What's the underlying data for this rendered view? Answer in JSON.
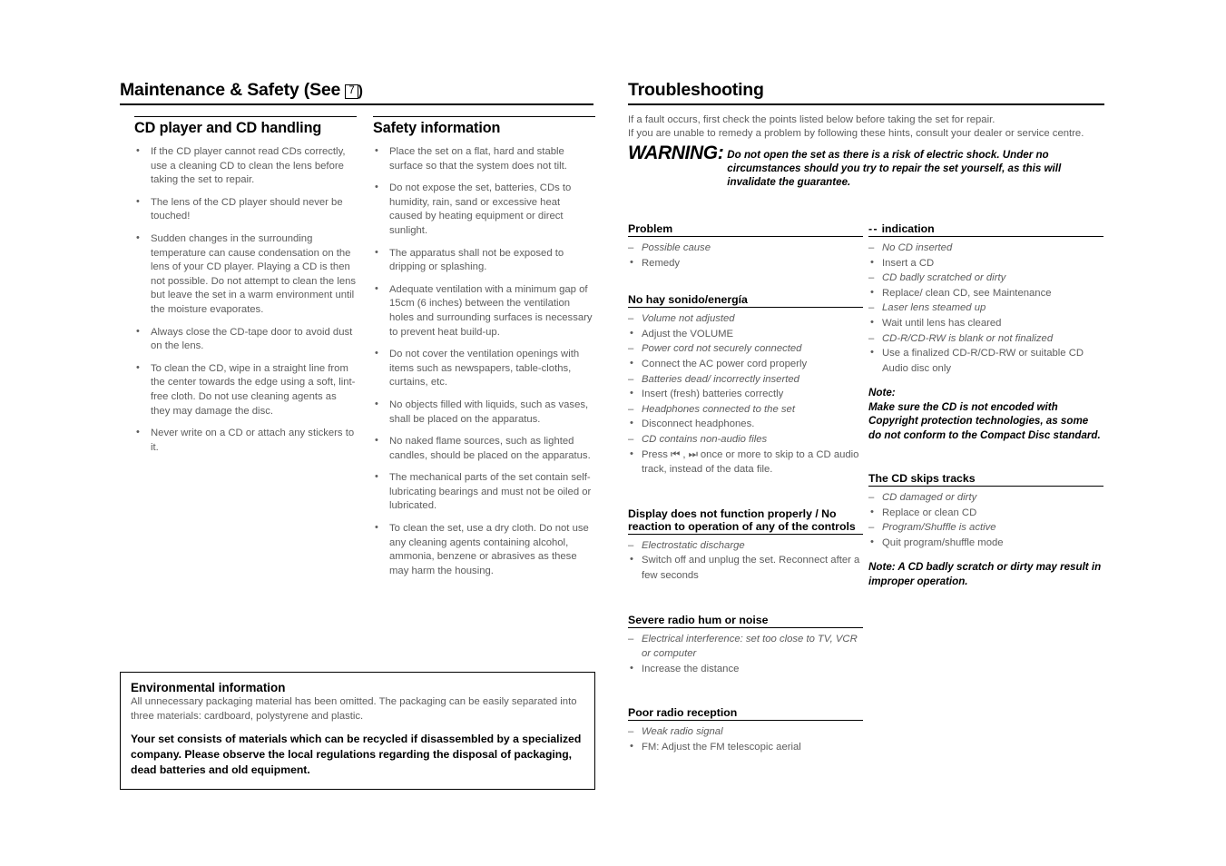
{
  "left": {
    "main_title_prefix": "Maintenance & Safety (See",
    "main_title_box": "7",
    "main_title_suffix": ")",
    "sections": [
      {
        "title": "CD player and CD handling",
        "bullets": [
          "If the CD player cannot read CDs correctly, use a cleaning CD to clean the lens before taking the set to repair.",
          "The lens of the CD player should never be touched!",
          "Sudden changes in the surrounding temperature can cause condensation on the lens of your CD player. Playing a CD is then not possible. Do not attempt to clean the lens but leave the set in a warm environment until the moisture evaporates.",
          "Always close the CD-tape door to avoid dust on the lens.",
          "To clean the CD, wipe in a straight line from the center towards the edge using a soft, lint-free cloth. Do not use cleaning agents as they may damage the disc.",
          "Never write on a CD or attach any stickers to it."
        ]
      },
      {
        "title": "Safety information",
        "bullets": [
          "Place the set on a flat, hard and stable surface so that the system does not tilt.",
          "Do not expose the set, batteries, CDs to humidity, rain, sand or excessive heat caused by heating equipment or direct sunlight.",
          "The apparatus shall not be exposed to dripping or splashing.",
          "Adequate ventilation with a minimum gap of 15cm (6 inches) between the ventilation holes and surrounding surfaces is necessary to prevent heat build-up.",
          "Do not cover the ventilation openings with items such as newspapers, table-cloths, curtains, etc.",
          "No objects filled with liquids, such as vases, shall be placed on the apparatus.",
          "No naked flame sources, such as lighted candles, should be placed on the apparatus.",
          "The mechanical parts of the set contain self-lubricating bearings and must not be oiled or lubricated.",
          "To clean the set, use a dry cloth. Do not use any cleaning agents containing alcohol, ammonia, benzene or abrasives as these may harm the housing."
        ]
      }
    ],
    "environmental": {
      "title": "Environmental information",
      "paragraph": "All unnecessary packaging material has been omitted. The packaging can be easily separated into three materials: cardboard, polystyrene and plastic.",
      "bold_paragraph": "Your set consists of materials which can be recycled if disassembled by a specialized company. Please observe the local regulations regarding the disposal of packaging, dead batteries and old equipment."
    }
  },
  "right": {
    "title": "Troubleshooting",
    "intro_line_1": "If a fault occurs, first check the points listed below before taking the set for repair.",
    "intro_line_2": "If you are unable to remedy a problem by following these hints, consult your dealer or service centre.",
    "warning_label": "WARNING:",
    "warning_text": "Do not open the set as there is a risk of electric shock. Under no circumstances should you try to repair the set yourself, as this will invalidate the guarantee.",
    "col_left": {
      "blocks": [
        {
          "heading": "Problem",
          "dash_prefix": "",
          "items": [
            {
              "kind": "cause",
              "text": "Possible cause"
            },
            {
              "kind": "remedy",
              "text": "Remedy"
            }
          ]
        },
        {
          "heading": "No hay sonido/energía",
          "dash_prefix": "",
          "items": [
            {
              "kind": "cause",
              "text": "Volume not adjusted"
            },
            {
              "kind": "remedy",
              "text": "Adjust the VOLUME"
            },
            {
              "kind": "cause",
              "text": "Power cord not securely connected"
            },
            {
              "kind": "remedy",
              "text": "Connect the AC power cord properly"
            },
            {
              "kind": "cause",
              "text": "Batteries dead/ incorrectly inserted"
            },
            {
              "kind": "remedy",
              "text": "Insert (fresh) batteries correctly"
            },
            {
              "kind": "cause",
              "text": "Headphones connected to the set"
            },
            {
              "kind": "remedy",
              "text": "Disconnect headphones."
            },
            {
              "kind": "cause",
              "text": "CD contains non-audio files"
            },
            {
              "kind": "remedy",
              "text": "Press ⏮ , ⏭ once or more to skip to a CD audio track, instead of the data file."
            }
          ]
        },
        {
          "heading": "Display does not function properly / No reaction to operation of any of the controls",
          "dash_prefix": "",
          "items": [
            {
              "kind": "cause",
              "text": "Electrostatic discharge"
            },
            {
              "kind": "remedy",
              "text": "Switch off and unplug the set. Reconnect after a few seconds"
            }
          ]
        },
        {
          "heading": "Severe radio hum or noise",
          "dash_prefix": "",
          "items": [
            {
              "kind": "cause",
              "text": "Electrical interference: set too close to TV, VCR or computer"
            },
            {
              "kind": "remedy",
              "text": "Increase the distance"
            }
          ]
        },
        {
          "heading": "Poor radio reception",
          "dash_prefix": "",
          "items": [
            {
              "kind": "cause",
              "text": "Weak radio signal"
            },
            {
              "kind": "remedy",
              "text": "FM: Adjust the FM telescopic aerial"
            }
          ]
        }
      ]
    },
    "col_right": {
      "blocks": [
        {
          "heading": "indication",
          "dash_prefix": "- -",
          "items": [
            {
              "kind": "cause",
              "text": "No CD inserted"
            },
            {
              "kind": "remedy",
              "text": "Insert a CD"
            },
            {
              "kind": "cause",
              "text": "CD badly scratched or dirty"
            },
            {
              "kind": "remedy",
              "text": "Replace/ clean CD, see Maintenance"
            },
            {
              "kind": "cause",
              "text": "Laser lens steamed up"
            },
            {
              "kind": "remedy",
              "text": "Wait until lens has cleared"
            },
            {
              "kind": "cause",
              "text": "CD-R/CD-RW is blank or not finalized"
            },
            {
              "kind": "remedy",
              "text": "Use a finalized CD-R/CD-RW or suitable CD Audio disc only"
            }
          ],
          "note": "Note:\nMake sure the CD is not encoded with Copyright protection technologies, as some do not conform to the Compact Disc standard."
        },
        {
          "heading": "The CD skips tracks",
          "dash_prefix": "",
          "items": [
            {
              "kind": "cause",
              "text": "CD damaged or dirty"
            },
            {
              "kind": "remedy",
              "text": "Replace or clean CD"
            },
            {
              "kind": "cause",
              "text": "Program/Shuffle is active"
            },
            {
              "kind": "remedy",
              "text": "Quit program/shuffle mode"
            }
          ],
          "note": "Note: A CD badly scratch or dirty may result in improper operation."
        }
      ]
    }
  },
  "colors": {
    "body_text": "#5c5c5c",
    "heading_text": "#000000",
    "rule": "#000000",
    "background": "#ffffff"
  }
}
